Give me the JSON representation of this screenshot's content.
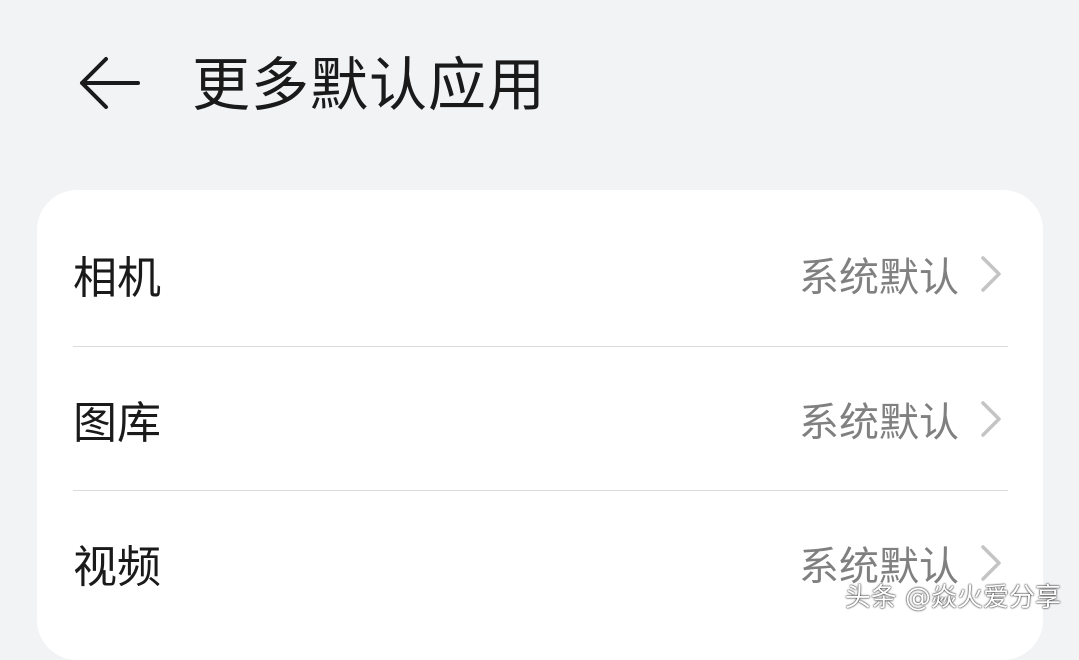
{
  "header": {
    "back_icon": "arrow-left-icon",
    "title": "更多默认应用"
  },
  "settings": {
    "items": [
      {
        "label": "相机",
        "value": "系统默认",
        "chevron_icon": "chevron-right-icon"
      },
      {
        "label": "图库",
        "value": "系统默认",
        "chevron_icon": "chevron-right-icon"
      },
      {
        "label": "视频",
        "value": "系统默认",
        "chevron_icon": "chevron-right-icon"
      }
    ]
  },
  "watermark": {
    "text": "头条 @焱火爱分享"
  },
  "colors": {
    "background": "#f2f3f5",
    "card": "#ffffff",
    "title_text": "#1a1a1a",
    "value_text": "#808080",
    "divider": "#dcdcdc"
  }
}
